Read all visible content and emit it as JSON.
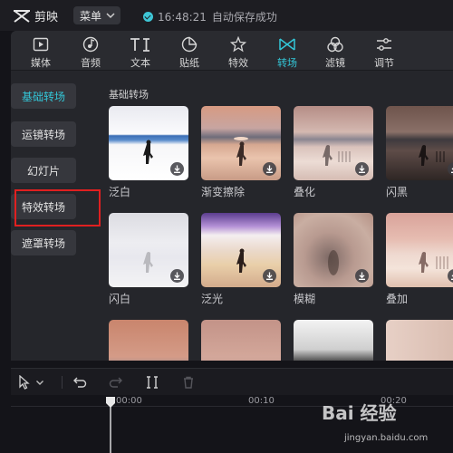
{
  "app": {
    "name": "剪映",
    "menu_label": "菜单",
    "save_time": "16:48:21",
    "save_text": "自动保存成功"
  },
  "tabs": [
    {
      "label": "媒体",
      "icon": "media-icon"
    },
    {
      "label": "音频",
      "icon": "audio-icon"
    },
    {
      "label": "文本",
      "icon": "text-icon"
    },
    {
      "label": "贴纸",
      "icon": "sticker-icon"
    },
    {
      "label": "特效",
      "icon": "effects-icon"
    },
    {
      "label": "转场",
      "icon": "transition-icon",
      "active": true
    },
    {
      "label": "滤镜",
      "icon": "filter-icon"
    },
    {
      "label": "调节",
      "icon": "adjust-icon"
    }
  ],
  "categories": [
    {
      "label": "基础转场",
      "active": true
    },
    {
      "label": "运镜转场"
    },
    {
      "label": "幻灯片"
    },
    {
      "label": "特效转场",
      "highlighted": true
    },
    {
      "label": "遮罩转场"
    }
  ],
  "section_title": "基础转场",
  "transitions": [
    {
      "name": "泛白"
    },
    {
      "name": "渐变擦除"
    },
    {
      "name": "叠化"
    },
    {
      "name": "闪黑"
    },
    {
      "name": "闪白"
    },
    {
      "name": "泛光"
    },
    {
      "name": "模糊"
    },
    {
      "name": "叠加"
    }
  ],
  "timeline": {
    "ticks": [
      "00:00",
      "00:10",
      "00:20"
    ]
  },
  "watermark": {
    "brand": "Bai 经验",
    "url": "jingyan.baidu.com"
  },
  "colors": {
    "accent": "#33c7d8",
    "highlight_box": "#e02020",
    "panel": "#25262b"
  }
}
